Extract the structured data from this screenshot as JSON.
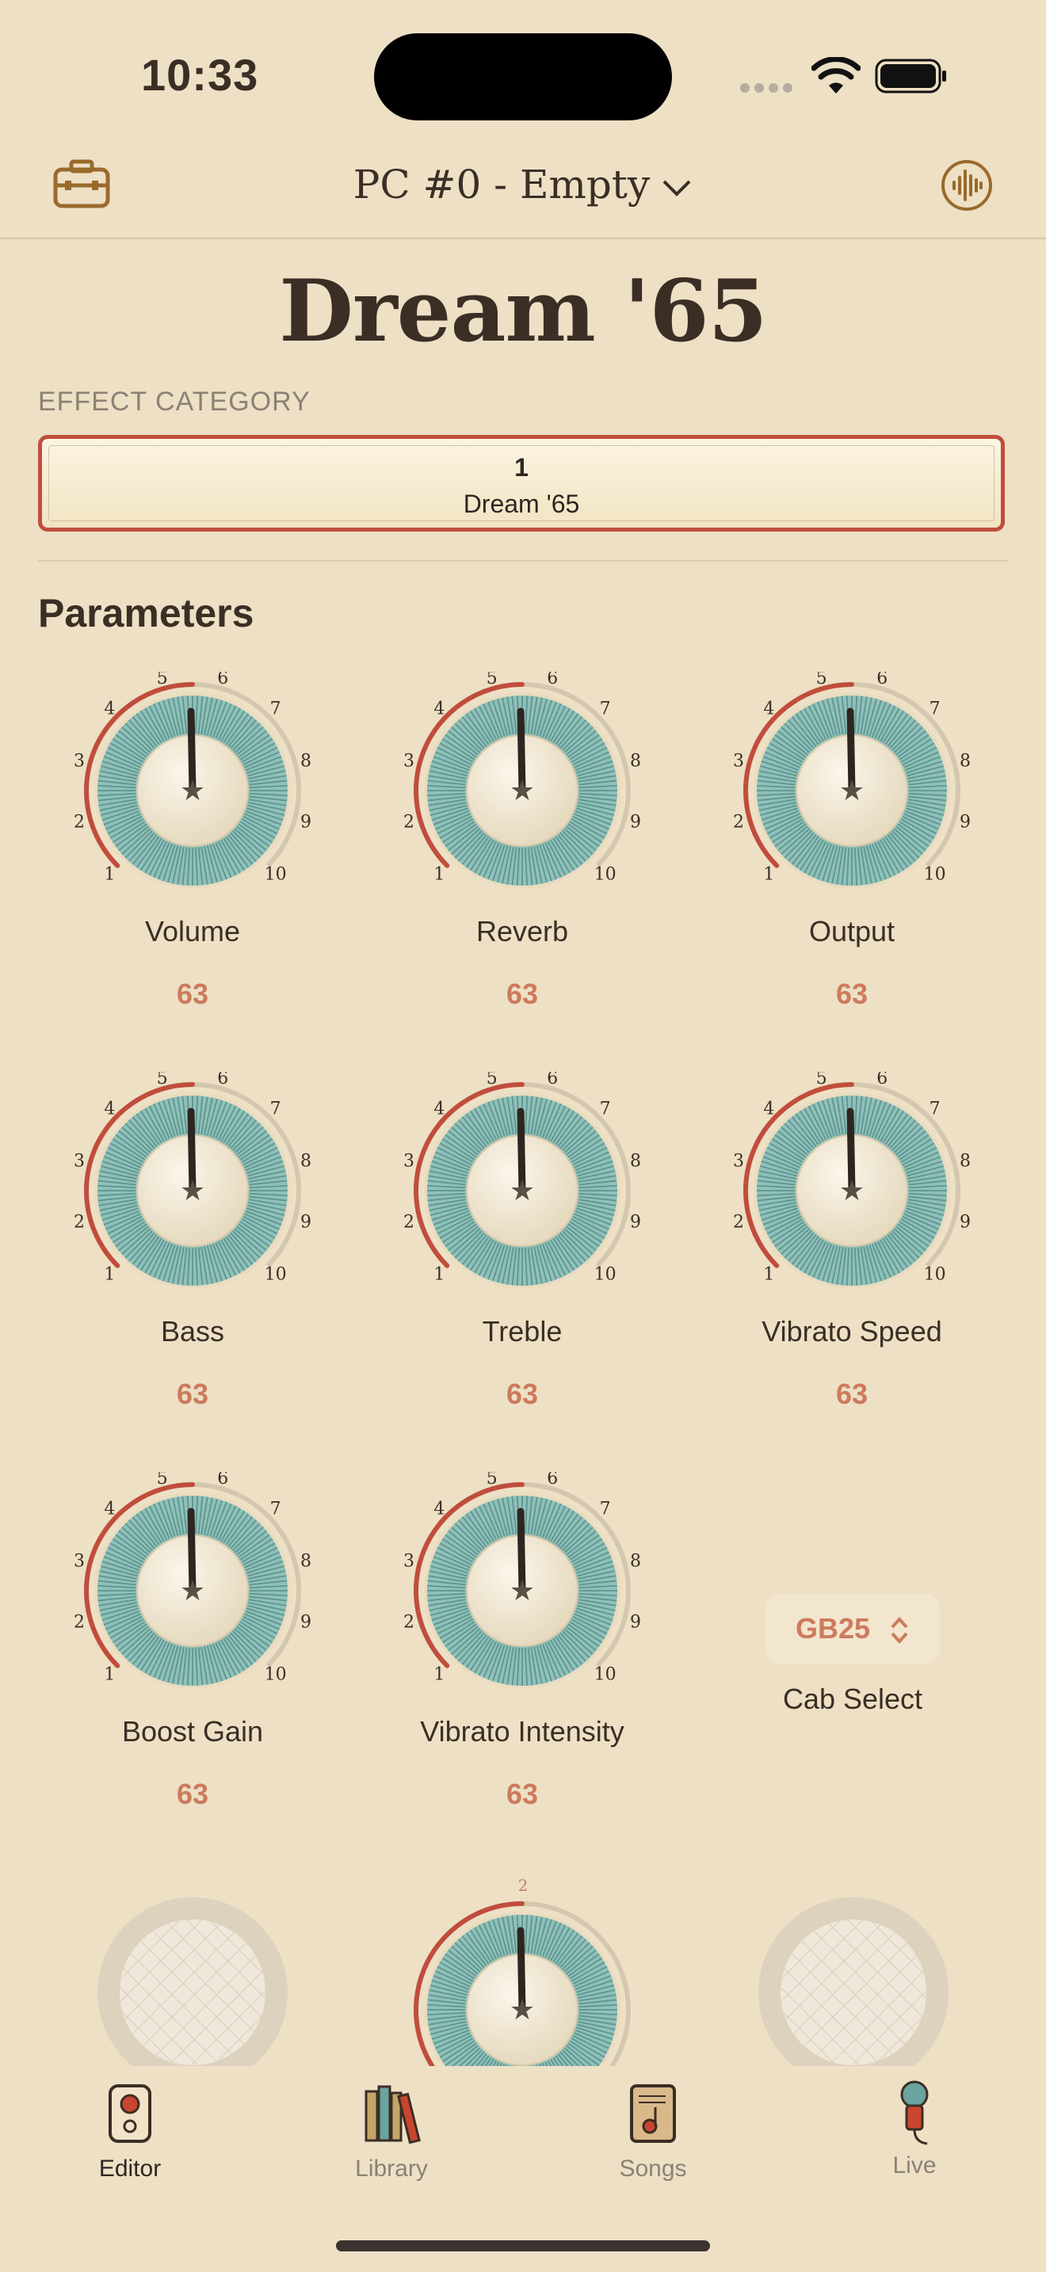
{
  "status_bar": {
    "time": "10:33"
  },
  "nav": {
    "title": "PC #0 - Empty"
  },
  "amp": {
    "title": "Dream '65"
  },
  "effect_category": {
    "label": "EFFECT CATEGORY",
    "number": "1",
    "name": "Dream '65"
  },
  "parameters": {
    "title": "Parameters",
    "knobs": [
      {
        "label": "Volume",
        "value": "63"
      },
      {
        "label": "Reverb",
        "value": "63"
      },
      {
        "label": "Output",
        "value": "63"
      },
      {
        "label": "Bass",
        "value": "63"
      },
      {
        "label": "Treble",
        "value": "63"
      },
      {
        "label": "Vibrato Speed",
        "value": "63"
      },
      {
        "label": "Boost Gain",
        "value": "63"
      },
      {
        "label": "Vibrato Intensity",
        "value": "63"
      }
    ],
    "cab_select": {
      "value": "GB25",
      "label": "Cab Select"
    },
    "partial_knob_tick": "2"
  },
  "tabs": [
    {
      "label": "Editor",
      "icon": "amp-speaker-icon",
      "selected": true
    },
    {
      "label": "Library",
      "icon": "books-icon",
      "selected": false
    },
    {
      "label": "Songs",
      "icon": "song-sheet-icon",
      "selected": false
    },
    {
      "label": "Live",
      "icon": "microphone-icon",
      "selected": false
    }
  ],
  "colors": {
    "background": "#ede0c5",
    "accent_red": "#c14d3c",
    "value_orange": "#cd7a5d",
    "knob_teal": "#6ba39e",
    "icon_brown": "#9a6a2b"
  },
  "knob_scale": [
    "1",
    "2",
    "3",
    "4",
    "5",
    "6",
    "7",
    "8",
    "9",
    "10"
  ]
}
